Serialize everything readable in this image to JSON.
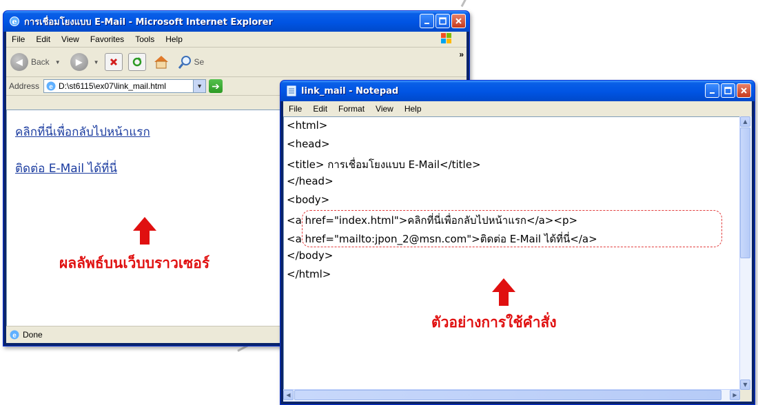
{
  "ie": {
    "title": "การเชื่อมโยงแบบ E-Mail - Microsoft Internet Explorer",
    "menu": [
      "File",
      "Edit",
      "View",
      "Favorites",
      "Tools",
      "Help"
    ],
    "toolbar": {
      "back_label": "Back",
      "search_label": "Se"
    },
    "address": {
      "label": "Address",
      "value": "D:\\st6115\\ex07\\link_mail.html"
    },
    "links": [
      "คลิกที่นี่เพื่อกลับไปหน้าแรก",
      "ติดต่อ E-Mail ได้ที่นี่"
    ],
    "status": "Done"
  },
  "notepad": {
    "title": "link_mail - Notepad",
    "menu": [
      "File",
      "Edit",
      "Format",
      "View",
      "Help"
    ],
    "lines": [
      "<html>",
      "<head>",
      "   <title> การเชื่อมโยงแบบ E-Mail</title>",
      "</head>",
      "<body>",
      "   <a href=\"index.html\">คลิกที่นี่เพื่อกลับไปหน้าแรก</a><p>",
      "   <a href=\"mailto:jpon_2@msn.com\">ติดต่อ E-Mail ได้ที่นี่</a>",
      "</body>",
      "</html>"
    ]
  },
  "annotations": {
    "browser_result": "ผลลัพธ์บนเว็บบราวเซอร์",
    "command_example": "ตัวอย่างการใช้คำสั่ง"
  },
  "colors": {
    "annotation": "#e01010",
    "titlebar": "#0054e3",
    "link": "#1a3b9f"
  }
}
